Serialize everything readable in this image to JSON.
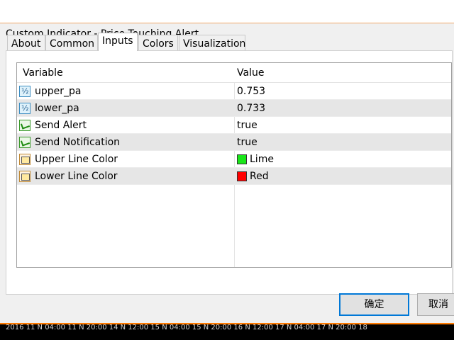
{
  "window": {
    "title": "Custom Indicator - Price Touching Alert"
  },
  "tabs": [
    {
      "label": "About",
      "active": false
    },
    {
      "label": "Common",
      "active": false
    },
    {
      "label": "Inputs",
      "active": true
    },
    {
      "label": "Colors",
      "active": false
    },
    {
      "label": "Visualization",
      "active": false
    }
  ],
  "table": {
    "headers": {
      "variable": "Variable",
      "value": "Value"
    },
    "rows": [
      {
        "icon": "double-value-icon",
        "name": "upper_pa",
        "value": "0.753"
      },
      {
        "icon": "double-value-icon",
        "name": "lower_pa",
        "value": "0.733"
      },
      {
        "icon": "boolean-icon",
        "name": "Send Alert",
        "value": "true"
      },
      {
        "icon": "boolean-icon",
        "name": "Send Notification",
        "value": "true"
      },
      {
        "icon": "color-icon",
        "name": "Upper Line Color",
        "value": "Lime",
        "swatch": "#19e619"
      },
      {
        "icon": "color-icon",
        "name": "Lower Line Color",
        "value": "Red",
        "swatch": "#ff0000"
      }
    ]
  },
  "buttons": {
    "ok": "确定",
    "cancel": "取消"
  },
  "taskbar": {
    "text": "2016 11 N 04:00 11 N 20:00 14 N 12:00 15 N 04:00 15 N 20:00 16 N 12:00 17 N 04:00 17 N 20:00 18"
  },
  "colors": {
    "accent": "#0078d7",
    "title_border": "#f1a768",
    "row_alt": "#e6e6e6"
  }
}
